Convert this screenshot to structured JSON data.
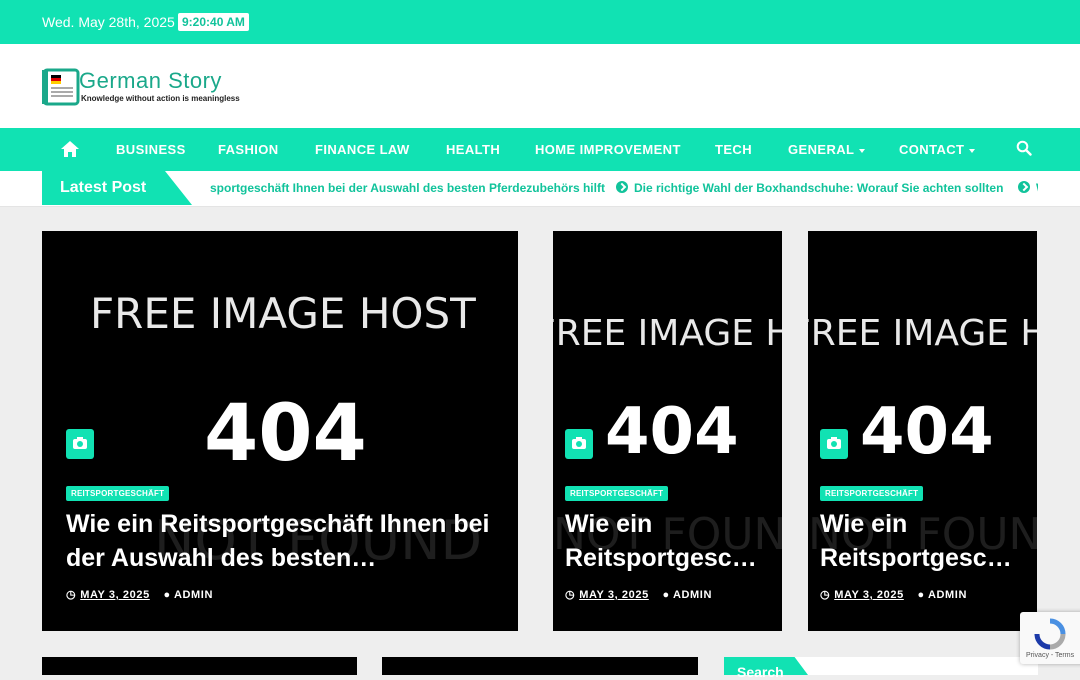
{
  "topbar": {
    "date": "Wed. May 28th, 2025",
    "time": "9:20:40 AM"
  },
  "header": {
    "brand": "German Story",
    "tagline": "Knowledge without action is meaningless"
  },
  "nav": {
    "items": [
      "BUSINESS",
      "FASHION",
      "FINANCE LAW",
      "HEALTH",
      "HOME IMPROVEMENT",
      "TECH",
      "GENERAL",
      "CONTACT"
    ],
    "home_icon": "home-icon",
    "search_icon": "search-icon"
  },
  "latest": {
    "label": "Latest Post",
    "items": [
      "sportgeschäft Ihnen bei der Auswahl des besten Pferdezubehörs hilft",
      "Die richtige Wahl der Boxhandschuhe: Worauf Sie achten sollten",
      "W"
    ]
  },
  "image_placeholder": {
    "line1": "FREE IMAGE HOST",
    "line2": "404",
    "line3": "NOT FOUND"
  },
  "featured": [
    {
      "category": "REITSPORTGESCHÄFT",
      "title": "Wie ein Reitsportgeschäft Ihnen bei der Auswahl des besten…",
      "date": "MAY 3, 2025",
      "author": "ADMIN"
    },
    {
      "category": "REITSPORTGESCHÄFT",
      "title": "Wie ein Reitsportgesc…",
      "date": "MAY 3, 2025",
      "author": "ADMIN"
    },
    {
      "category": "REITSPORTGESCHÄFT",
      "title": "Wie ein Reitsportgesc…",
      "date": "MAY 3, 2025",
      "author": "ADMIN"
    }
  ],
  "sidebar": {
    "search_title": "Search"
  },
  "recaptcha": {
    "links": "Privacy - Terms"
  },
  "colors": {
    "accent": "#11e2b3",
    "accent_dark": "#11c39b"
  }
}
